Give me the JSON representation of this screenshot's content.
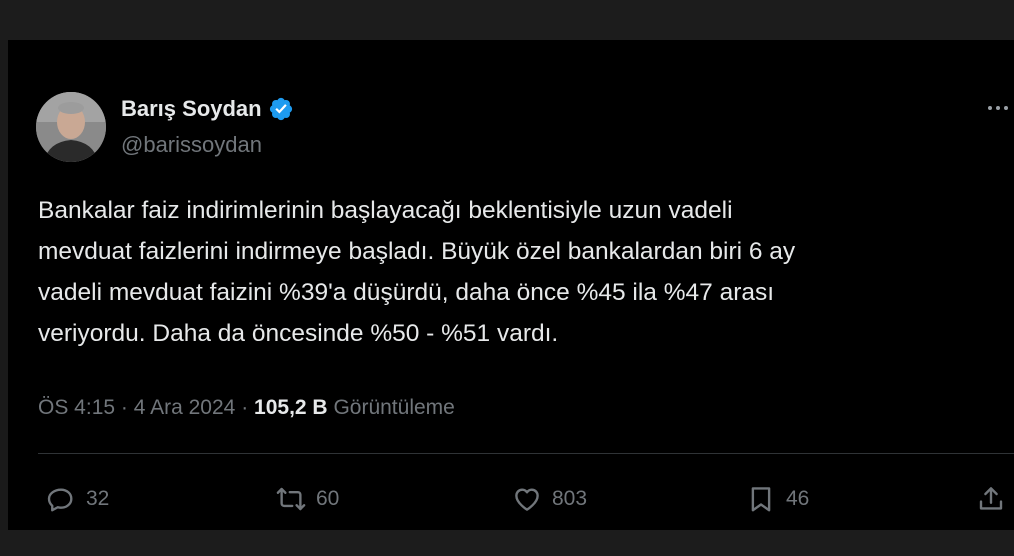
{
  "author": {
    "name": "Barış Soydan",
    "handle": "@barissoydan",
    "verified_icon": "verified-badge-icon",
    "verified_color": "#1d9bf0"
  },
  "tweet": {
    "lines": [
      "Bankalar faiz indirimlerinin başlayacağı beklentisiyle uzun vadeli",
      "mevduat faizlerini indirmeye başladı. Büyük özel bankalardan biri 6 ay",
      "vadeli mevduat faizini %39'a düşürdü, daha önce %45 ila %47 arası",
      "veriyordu. Daha da öncesinde %50 - %51 vardı."
    ]
  },
  "meta": {
    "time": "ÖS 4:15",
    "separator": "·",
    "date": "4 Ara 2024",
    "views_count": "105,2 B",
    "views_label": "Görüntüleme"
  },
  "actions": {
    "replies": "32",
    "reposts": "60",
    "likes": "803",
    "bookmarks": "46"
  },
  "colors": {
    "background": "#000000",
    "text": "#e7e9ea",
    "muted": "#71767b",
    "divider": "#2f3336"
  }
}
